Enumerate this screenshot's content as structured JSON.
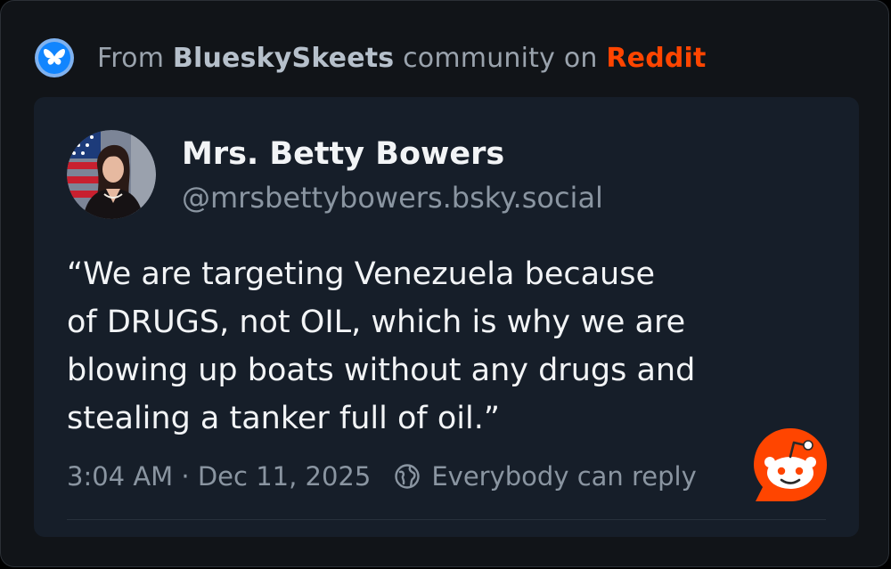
{
  "source": {
    "prefix": "From",
    "community": "BlueskySkeets",
    "middle": "community on",
    "platform": "Reddit",
    "bluesky_icon": "butterfly-icon",
    "colors": {
      "platform": "#ff4500",
      "bluesky": "#1185fe"
    }
  },
  "post": {
    "display_name": "Mrs. Betty Bowers",
    "handle": "@mrsbettybowers.bsky.social",
    "text": "“We are targeting Venezuela because\nof DRUGS, not OIL, which is why we are\nblowing up boats without any drugs and\nstealing a tanker full of oil.”",
    "timestamp": "3:04 AM · Dec 11, 2025",
    "reply_setting": "Everybody can reply",
    "reply_icon": "globe-icon",
    "badge_icon": "reddit-icon"
  }
}
